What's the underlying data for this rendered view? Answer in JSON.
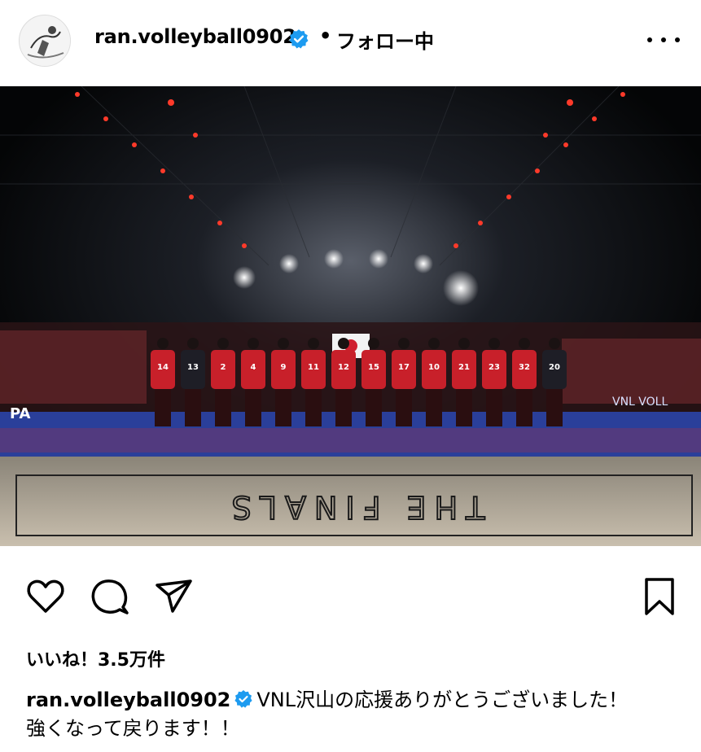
{
  "post": {
    "username": "ran.volleyball0902",
    "dot": "•",
    "follow_status": "フォロー中"
  },
  "photo": {
    "court_text": "THE FINALS",
    "banner_left": "PA",
    "banner_right": "VNL VOLL",
    "jersey_numbers": [
      "14",
      "13",
      "2",
      "4",
      "9",
      "11",
      "12",
      "15",
      "17",
      "10",
      "21",
      "23",
      "32",
      "20"
    ]
  },
  "likes": {
    "text": "いいね！3.5万件"
  },
  "caption": {
    "username": "ran.volleyball0902",
    "text": "VNL沢山の応援ありがとうございました！",
    "text2": "強くなって戻ります！！"
  },
  "colors": {
    "verified": "#1d9bf0",
    "jersey": "#c8202a",
    "court_blue": "#2a3f9a"
  }
}
